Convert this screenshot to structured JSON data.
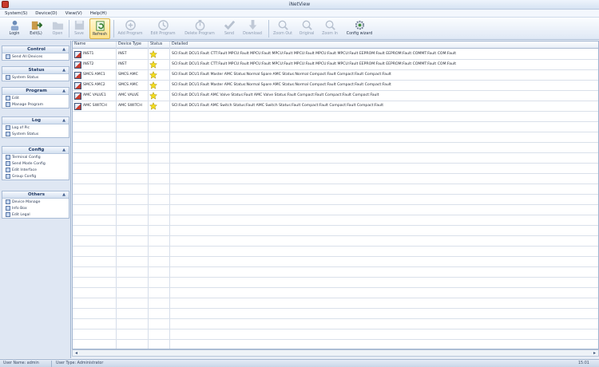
{
  "window": {
    "title": "iNetView"
  },
  "menu": [
    "System(S)",
    "Device(D)",
    "View(V)",
    "Help(H)"
  ],
  "toolbar": [
    {
      "label": "Login",
      "icon": "login-icon",
      "enabled": true
    },
    {
      "label": "Exit(L)",
      "icon": "exit-icon",
      "enabled": true
    },
    {
      "label": "Open",
      "icon": "open-folder-icon",
      "enabled": false
    },
    {
      "label": "Save",
      "icon": "save-icon",
      "enabled": false
    },
    {
      "label": "Refresh",
      "icon": "refresh-icon",
      "enabled": true,
      "active": true
    },
    {
      "label": "Add Program",
      "icon": "add-program-icon",
      "enabled": false
    },
    {
      "label": "Edit Program",
      "icon": "edit-program-icon",
      "enabled": false
    },
    {
      "label": "Delete Program",
      "icon": "delete-program-icon",
      "enabled": false
    },
    {
      "label": "Send",
      "icon": "send-icon",
      "enabled": false
    },
    {
      "label": "Download",
      "icon": "download-icon",
      "enabled": false
    },
    {
      "label": "Zoom Out",
      "icon": "zoom-out-icon",
      "enabled": false
    },
    {
      "label": "Original",
      "icon": "zoom-original-icon",
      "enabled": false
    },
    {
      "label": "Zoom In",
      "icon": "zoom-in-icon",
      "enabled": false
    },
    {
      "label": "Config wizard",
      "icon": "config-wizard-icon",
      "enabled": true
    }
  ],
  "sidebar": [
    {
      "title": "Control",
      "items": [
        "Send All Devices"
      ]
    },
    {
      "title": "Status",
      "items": [
        "System Status"
      ]
    },
    {
      "title": "Program",
      "items": [
        "Edit",
        "Manage Program"
      ]
    },
    {
      "title": "Log",
      "items": [
        "Log of Pic",
        "System Status"
      ]
    },
    {
      "title": "Config",
      "items": [
        "Terminal Config",
        "Send Mode Config",
        "Edit Interface",
        "Group Config"
      ]
    },
    {
      "title": "Others",
      "items": [
        "Device Manage",
        "Info Box",
        "Edit Legal"
      ]
    }
  ],
  "table": {
    "columns": [
      "Name",
      "Device Type",
      "Status",
      "Detailed"
    ],
    "rows": [
      {
        "name": "INST1",
        "type": "INST",
        "detail": "SCI:Fault   DCU1:Fault   CTT:Fault   MPCU:Fault  MPCU:Fault  MPCU:Fault  MPCU:Fault   MPCU:Fault  MPCU:Fault  EEPROM:Fault  EEPROM:Fault  COMMT:Fault  COM:Fault"
      },
      {
        "name": "INST2",
        "type": "INST",
        "detail": "SCI:Fault   DCU1:Fault   CTT:Fault   MPCU:Fault  MPCU:Fault  MPCU:Fault  MPCU:Fault   MPCU:Fault  MPCU:Fault  EEPROM:Fault  EEPROM:Fault  COMMT:Fault  COM:Fault"
      },
      {
        "name": "SMCS AMC1",
        "type": "SMCS AMC",
        "detail": "SCI:Fault   DCU1:Fault   Master AMC Status:Normal   Spare AMC Status:Normal   Compact:Fault  Compact:Fault  Compact:Fault"
      },
      {
        "name": "SMCS AMC2",
        "type": "SMCS AMC",
        "detail": "SCI:Fault   DCU1:Fault   Master AMC Status:Normal   Spare AMC Status:Normal   Compact:Fault  Compact:Fault  Compact:Fault"
      },
      {
        "name": "AMC VALVE1",
        "type": "AMC VALVE",
        "detail": "SCI:Fault   DCU1:Fault   AMC Valve Status:Fault   AMC Valve Status:Fault   Compact:Fault  Compact:Fault  Compact:Fault"
      },
      {
        "name": "AMC SWITCH",
        "type": "AMC SWITCH",
        "detail": "SCI:Fault   DCU1:Fault   AMC Switch Status:Fault   AMC Switch Status:Fault   Compact:Fault  Compact:Fault  Compact:Fault"
      }
    ],
    "status_color": "#f2dc1d"
  },
  "statusbar": {
    "user": "User Name: admin",
    "type": "User Type: Administrator",
    "time": "15:01"
  }
}
